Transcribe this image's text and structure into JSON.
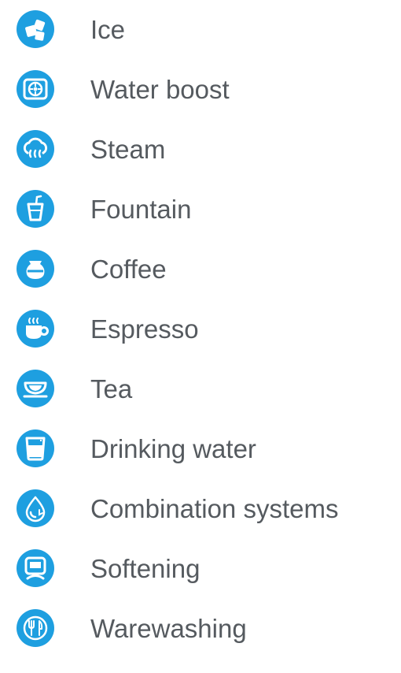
{
  "accent_color": "#1e9fe0",
  "items": [
    {
      "label": "Ice",
      "icon": "ice-icon"
    },
    {
      "label": "Water boost",
      "icon": "water-boost-icon"
    },
    {
      "label": "Steam",
      "icon": "steam-icon"
    },
    {
      "label": "Fountain",
      "icon": "fountain-icon"
    },
    {
      "label": "Coffee",
      "icon": "coffee-icon"
    },
    {
      "label": "Espresso",
      "icon": "espresso-icon"
    },
    {
      "label": "Tea",
      "icon": "tea-icon"
    },
    {
      "label": "Drinking water",
      "icon": "drinking-water-icon"
    },
    {
      "label": "Combination systems",
      "icon": "combination-systems-icon"
    },
    {
      "label": "Softening",
      "icon": "softening-icon"
    },
    {
      "label": "Warewashing",
      "icon": "warewashing-icon"
    }
  ]
}
